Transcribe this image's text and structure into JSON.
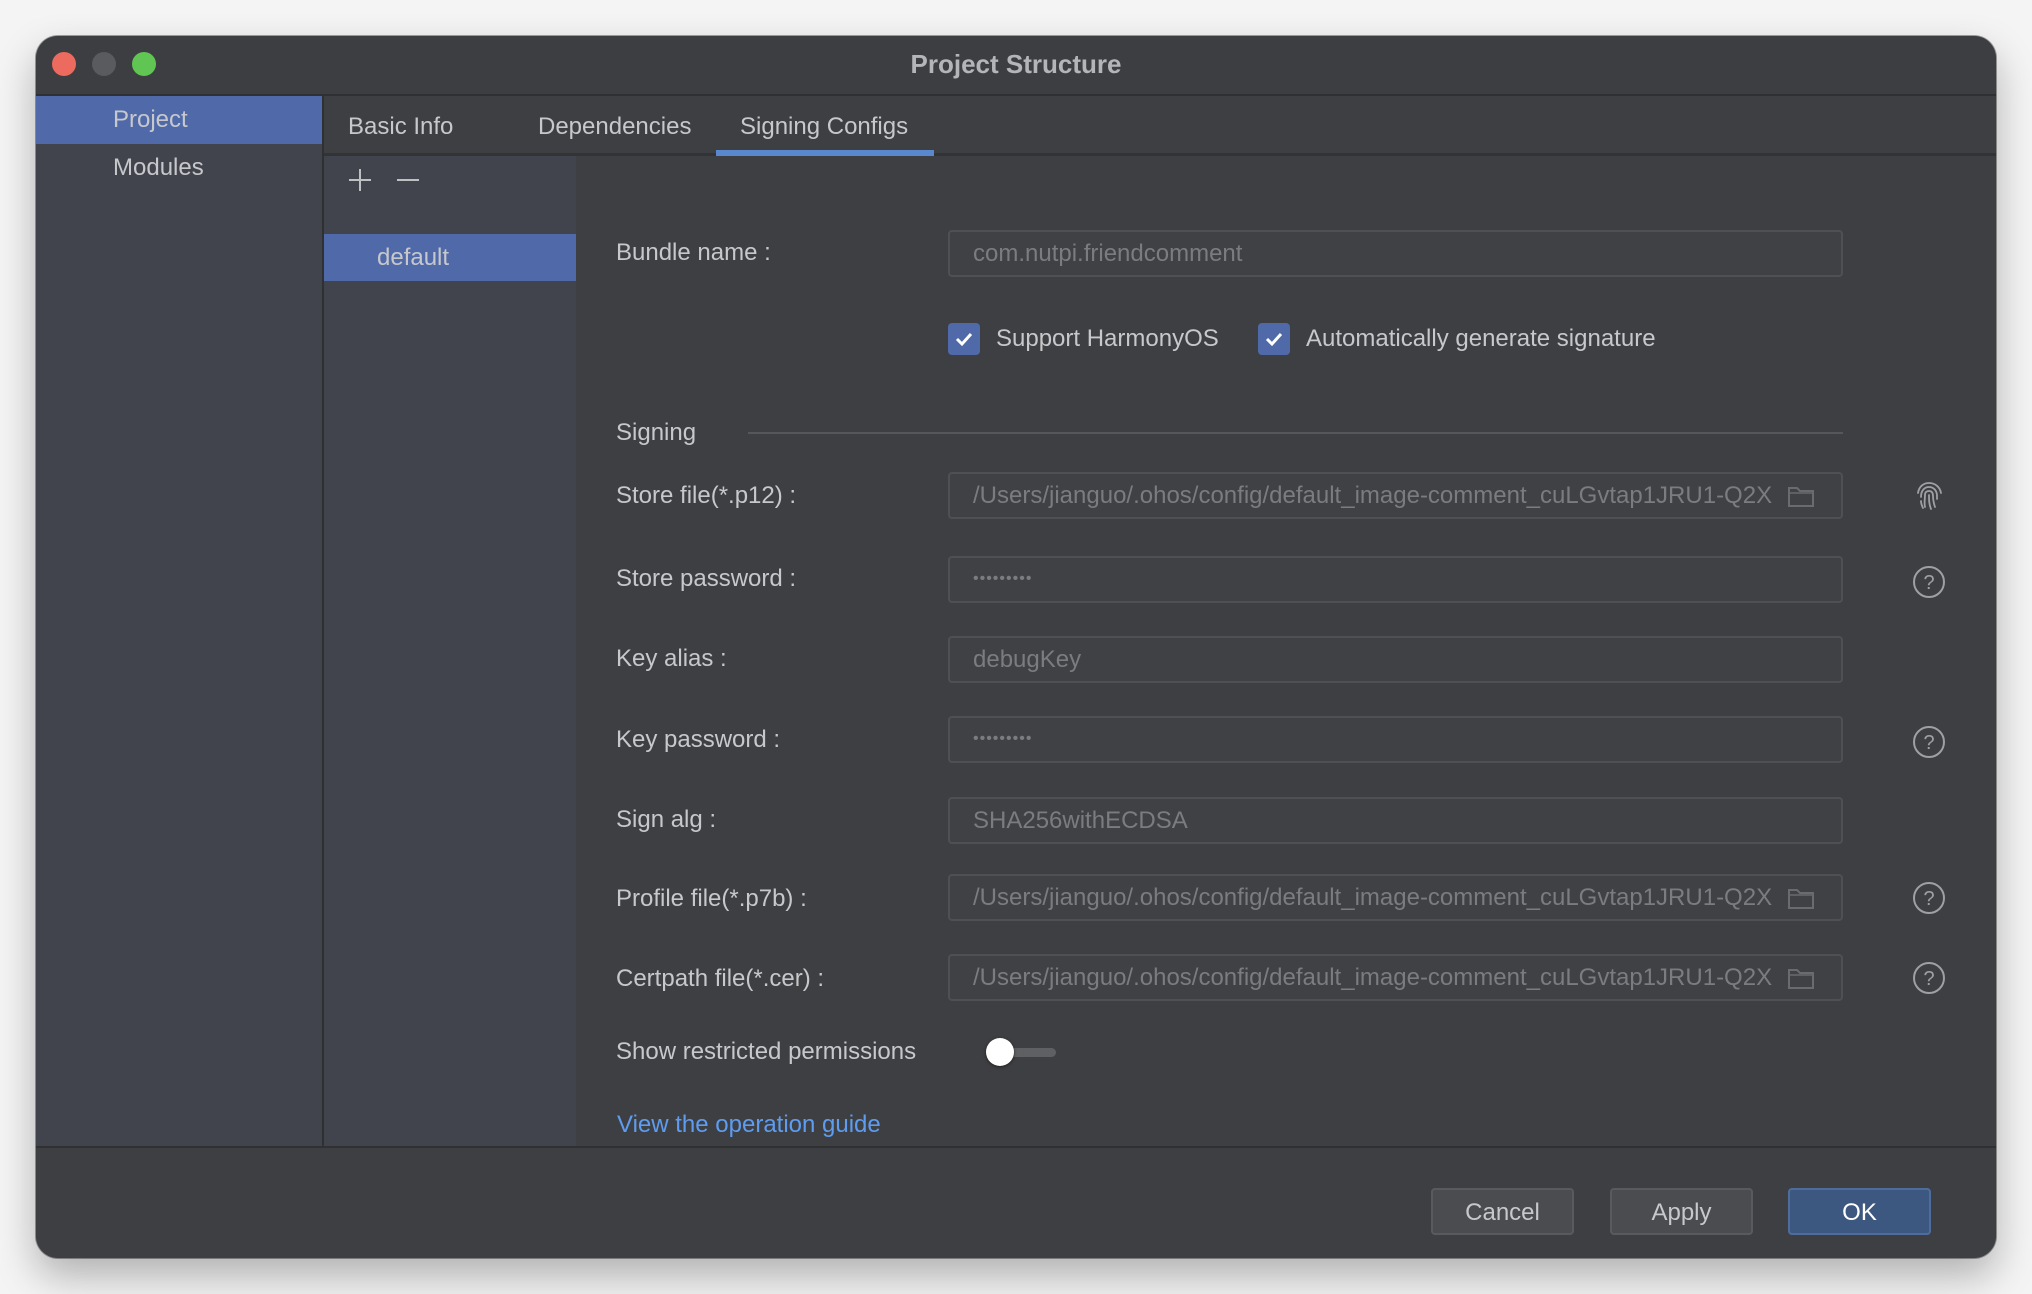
{
  "window": {
    "title": "Project Structure",
    "traffic_lights": [
      "close",
      "minimize",
      "maximize"
    ]
  },
  "sidebar": {
    "items": [
      {
        "label": "Project",
        "selected": true
      },
      {
        "label": "Modules",
        "selected": false
      }
    ]
  },
  "tabs": [
    {
      "label": "Basic Info",
      "active": false
    },
    {
      "label": "Dependencies",
      "active": false
    },
    {
      "label": "Signing Configs",
      "active": true
    }
  ],
  "config_list": {
    "add_icon": "plus-icon",
    "remove_icon": "minus-icon",
    "items": [
      {
        "label": "default",
        "selected": true
      }
    ]
  },
  "form": {
    "bundle_name": {
      "label": "Bundle name :",
      "value": "com.nutpi.friendcomment"
    },
    "checkboxes": [
      {
        "label": "Support HarmonyOS",
        "checked": true
      },
      {
        "label": "Automatically generate signature",
        "checked": true
      }
    ],
    "section_title": "Signing",
    "fields": [
      {
        "label": "Store file(*.p12) :",
        "value": "/Users/jianguo/.ohos/config/default_image-comment_cuLGvtap1JRU1-Q2X",
        "kind": "file",
        "side_icon": "fingerprint-icon"
      },
      {
        "label": "Store password :",
        "value": "•••••••••",
        "kind": "password",
        "side_icon": "help-icon"
      },
      {
        "label": "Key alias :",
        "value": "debugKey",
        "kind": "text",
        "side_icon": null
      },
      {
        "label": "Key password :",
        "value": "•••••••••",
        "kind": "password",
        "side_icon": "help-icon"
      },
      {
        "label": "Sign alg :",
        "value": "SHA256withECDSA",
        "kind": "text",
        "side_icon": null
      },
      {
        "label": "Profile file(*.p7b) :",
        "value": "/Users/jianguo/.ohos/config/default_image-comment_cuLGvtap1JRU1-Q2X",
        "kind": "file",
        "side_icon": "help-icon"
      },
      {
        "label": "Certpath file(*.cer) :",
        "value": "/Users/jianguo/.ohos/config/default_image-comment_cuLGvtap1JRU1-Q2X",
        "kind": "file",
        "side_icon": "help-icon"
      }
    ],
    "restricted_permissions": {
      "label": "Show restricted permissions",
      "enabled": false
    },
    "guide_link": "View the operation guide"
  },
  "footer": {
    "cancel": "Cancel",
    "apply": "Apply",
    "ok": "OK"
  },
  "colors": {
    "accent": "#506aa9",
    "link": "#5e9cf0",
    "primary_button": "#3d5880",
    "tab_underline": "#5a88cf"
  }
}
